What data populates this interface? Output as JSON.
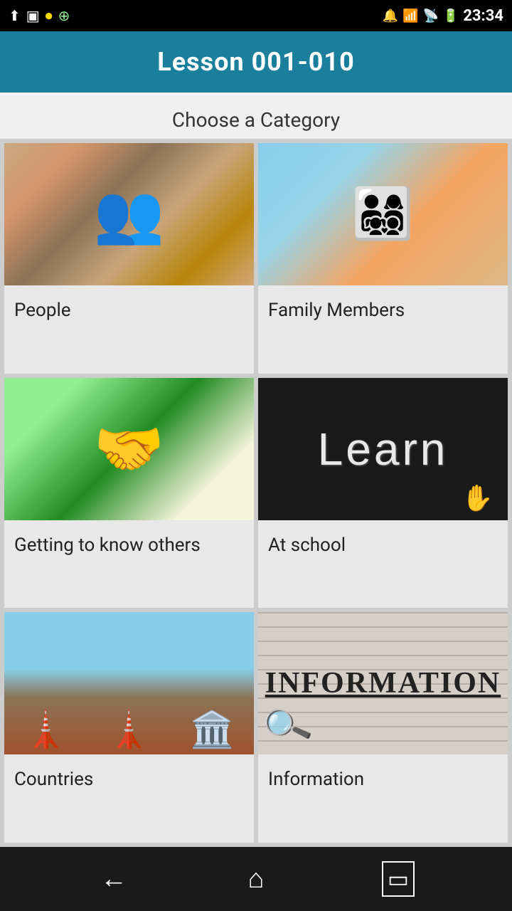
{
  "statusBar": {
    "time": "23:34",
    "icons_left": [
      "usb-icon",
      "image-icon",
      "record-icon",
      "speed-icon"
    ],
    "icons_right": [
      "hearing-icon",
      "wifi-icon",
      "signal-icon",
      "battery-icon"
    ]
  },
  "header": {
    "title": "Lesson 001-010"
  },
  "page": {
    "subtitle": "Choose a Category"
  },
  "categories": [
    {
      "id": "people",
      "label": "People",
      "imageType": "people"
    },
    {
      "id": "family-members",
      "label": "Family Members",
      "imageType": "family"
    },
    {
      "id": "getting-to-know-others",
      "label": "Getting to know others",
      "imageType": "getting"
    },
    {
      "id": "at-school",
      "label": "At school",
      "imageType": "school",
      "learnText": "Learn"
    },
    {
      "id": "landmarks",
      "label": "Countries",
      "imageType": "landmarks"
    },
    {
      "id": "information",
      "label": "Information",
      "imageType": "information",
      "infoWord": "INFORMATION"
    }
  ],
  "bottomNav": {
    "back_label": "←",
    "home_label": "⌂",
    "recent_label": "▭"
  }
}
